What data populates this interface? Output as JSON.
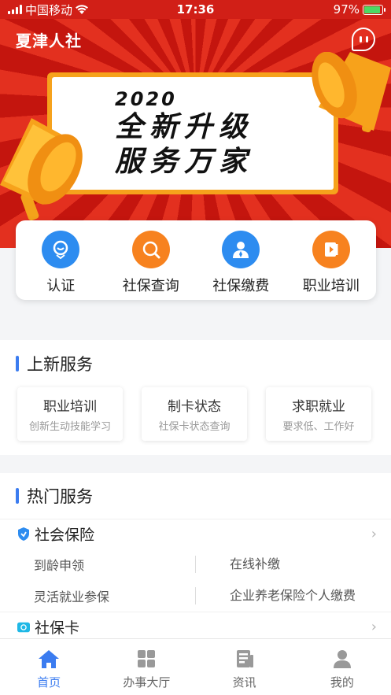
{
  "status_bar": {
    "carrier": "中国移动",
    "time": "17:36",
    "battery": "97%"
  },
  "header": {
    "title": "夏津人社",
    "message_icon": "chat-bubble-icon"
  },
  "banner": {
    "year": "2020",
    "line1": "全新升级",
    "line2": "服务万家"
  },
  "quick_menu": [
    {
      "label": "认证",
      "icon": "face-verify-icon",
      "color": "#2d8cf0"
    },
    {
      "label": "社保查询",
      "icon": "search-icon",
      "color": "#f7821f"
    },
    {
      "label": "社保缴费",
      "icon": "person-icon",
      "color": "#2d8cf0"
    },
    {
      "label": "职业培训",
      "icon": "book-icon",
      "color": "#f7821f"
    }
  ],
  "new_services": {
    "title": "上新服务",
    "items": [
      {
        "title": "职业培训",
        "subtitle": "创新生动技能学习"
      },
      {
        "title": "制卡状态",
        "subtitle": "社保卡状态查询"
      },
      {
        "title": "求职就业",
        "subtitle": "要求低、工作好"
      }
    ]
  },
  "hot_services": {
    "title": "热门服务",
    "groups": [
      {
        "name": "社会保险",
        "icon": "shield-icon",
        "rows": [
          [
            "到龄申领",
            "在线补缴"
          ],
          [
            "灵活就业参保",
            "企业养老保险个人缴费"
          ]
        ]
      },
      {
        "name": "社保卡",
        "icon": "card-icon"
      }
    ]
  },
  "tabbar": [
    {
      "label": "首页",
      "icon": "home-icon",
      "active": true
    },
    {
      "label": "办事大厅",
      "icon": "grid-icon",
      "active": false
    },
    {
      "label": "资讯",
      "icon": "news-icon",
      "active": false
    },
    {
      "label": "我的",
      "icon": "user-icon",
      "active": false
    }
  ],
  "colors": {
    "brand_red": "#d11f17",
    "accent_blue": "#3b7cf0",
    "accent_orange": "#f7821f"
  }
}
